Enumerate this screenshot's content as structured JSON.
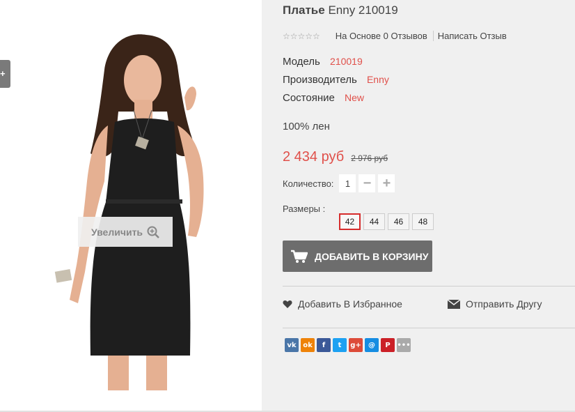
{
  "gallery": {
    "side_tab_icon": "plus-icon",
    "zoom_label": "Увеличить",
    "zoom_icon": "zoom-in-icon"
  },
  "product": {
    "title_name": "Платье",
    "title_rest": "Enny 210019",
    "rating_stars": "☆☆☆☆☆",
    "reviews_label": "На Основе 0 Отзывов",
    "write_review_label": "Написать Отзыв",
    "model_label": "Модель",
    "model_value": "210019",
    "manufacturer_label": "Производитель",
    "manufacturer_value": "Enny",
    "condition_label": "Состояние",
    "condition_value": "New",
    "material": "100% лен",
    "price": "2 434 руб",
    "old_price": "2 976 руб",
    "quantity_label": "Количество:",
    "quantity_value": "1",
    "minus": "−",
    "plus": "+",
    "sizes_label": "Размеры :",
    "sizes": [
      "42",
      "44",
      "46",
      "48"
    ],
    "selected_size": "42",
    "add_to_cart_label": "ДОБАВИТЬ В КОРЗИНУ",
    "wishlist_label": "Добавить В Избранное",
    "send_friend_label": "Отправить Другу"
  },
  "share": [
    {
      "name": "vk-icon",
      "glyph": "vk",
      "color": "#4a76a8"
    },
    {
      "name": "odnoklassniki-icon",
      "glyph": "ok",
      "color": "#ee8208"
    },
    {
      "name": "facebook-icon",
      "glyph": "f",
      "color": "#3b5998"
    },
    {
      "name": "twitter-icon",
      "glyph": "t",
      "color": "#1da1f2"
    },
    {
      "name": "google-plus-icon",
      "glyph": "g+",
      "color": "#dd4b39"
    },
    {
      "name": "mail-icon",
      "glyph": "@",
      "color": "#168de2"
    },
    {
      "name": "pinterest-icon",
      "glyph": "P",
      "color": "#cb2027"
    },
    {
      "name": "more-icon",
      "glyph": "•••",
      "color": "#aaaaaa"
    }
  ],
  "colors": {
    "accent": "#e0504a",
    "button": "#6d6d6d",
    "selected_size_border": "#d62c2c"
  }
}
